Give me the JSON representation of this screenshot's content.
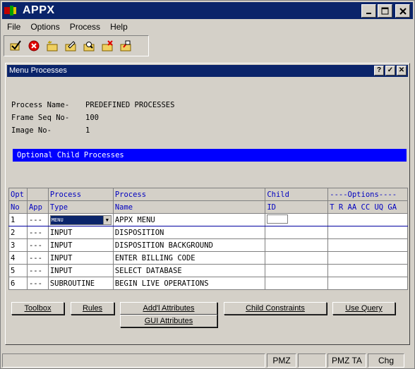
{
  "window": {
    "title": "APPX"
  },
  "menubar": {
    "items": [
      "File",
      "Options",
      "Process",
      "Help"
    ]
  },
  "toolbar": {
    "icons": [
      "check-icon",
      "cancel-icon",
      "new-icon",
      "edit-icon",
      "find-icon",
      "delete-icon",
      "copy-icon"
    ]
  },
  "dialog": {
    "title": "Menu Processes",
    "buttons": [
      "?",
      "✓",
      "✕"
    ],
    "info": [
      {
        "label": "Process Name-",
        "value": "PREDEFINED PROCESSES"
      },
      {
        "label": "Frame Seq No-",
        "value": "100"
      },
      {
        "label": "Image No-",
        "value": "1"
      }
    ],
    "section_title": "Optional Child Processes"
  },
  "grid": {
    "headers": {
      "row1": [
        "Opt",
        "",
        "Process",
        "Process",
        "Child",
        "----Options----"
      ],
      "row2": [
        "No",
        "App",
        "Type",
        "Name",
        "ID",
        "T R AA CC UQ GA"
      ]
    },
    "rows": [
      {
        "no": "1",
        "app": "---",
        "type": "MENU",
        "name": "APPX MENU",
        "child": "",
        "opts": ""
      },
      {
        "no": "2",
        "app": "---",
        "type": "INPUT",
        "name": "DISPOSITION",
        "child": "",
        "opts": ""
      },
      {
        "no": "3",
        "app": "---",
        "type": "INPUT",
        "name": "DISPOSITION BACKGROUND",
        "child": "",
        "opts": ""
      },
      {
        "no": "4",
        "app": "---",
        "type": "INPUT",
        "name": "ENTER BILLING CODE",
        "child": "",
        "opts": ""
      },
      {
        "no": "5",
        "app": "---",
        "type": "INPUT",
        "name": "SELECT DATABASE",
        "child": "",
        "opts": ""
      },
      {
        "no": "6",
        "app": "---",
        "type": "SUBROUTINE",
        "name": "BEGIN LIVE OPERATIONS",
        "child": "",
        "opts": ""
      }
    ]
  },
  "buttons": {
    "toolbox": "Toolbox",
    "rules": "Rules",
    "add_attributes": "Add'l Attributes",
    "child_constraints": "Child Constraints",
    "use_query": "Use Query",
    "gui_attributes": "GUI Attributes"
  },
  "statusbar": {
    "cells": [
      "",
      "PMZ",
      "",
      "PMZ TA",
      "Chg"
    ]
  }
}
